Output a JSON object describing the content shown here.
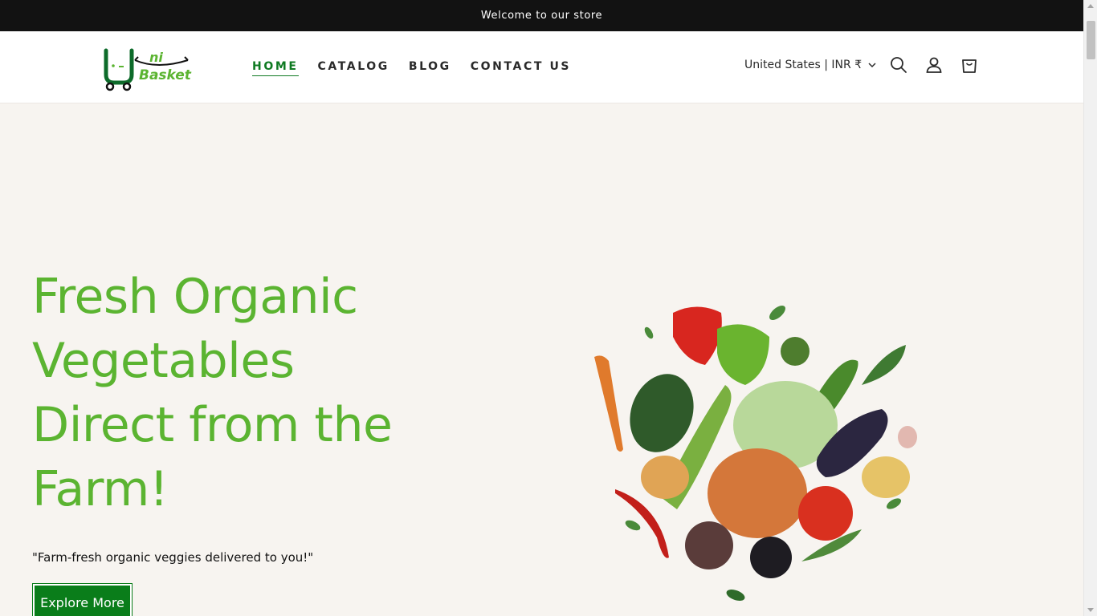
{
  "announcement": "Welcome to our store",
  "logo": {
    "letter_u": "U",
    "ni": "ni",
    "basket": "Basket"
  },
  "nav": {
    "items": [
      {
        "label": "HOME",
        "active": true
      },
      {
        "label": "CATALOG",
        "active": false
      },
      {
        "label": "BLOG",
        "active": false
      },
      {
        "label": "CONTACT US",
        "active": false
      }
    ]
  },
  "header": {
    "country_selector": "United States | INR ₹",
    "icons": [
      "search-icon",
      "account-icon",
      "cart-icon"
    ]
  },
  "hero": {
    "title": "Fresh Organic Vegetables Direct from the Farm!",
    "subtitle": "\"Farm-fresh organic veggies delivered to you!\"",
    "cta_label": "Explore More"
  },
  "colors": {
    "brand_green": "#5bb431",
    "button_green": "#0a7d1a",
    "nav_active": "#0f7a22",
    "announcement_bg": "#121212",
    "page_bg": "#f7f4f0"
  }
}
